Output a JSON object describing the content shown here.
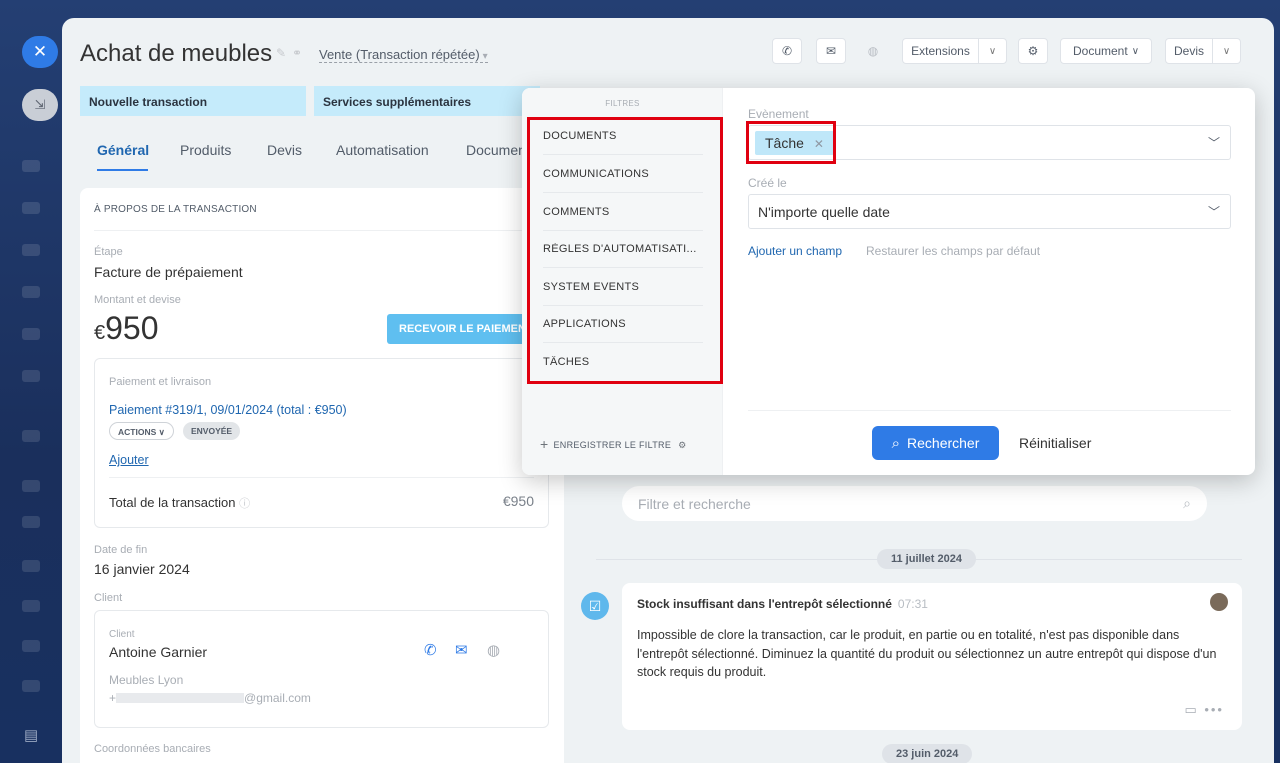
{
  "window": {
    "title": "Achat de meubles",
    "subtitle": "Vente (Transaction répétée)"
  },
  "toolbar": {
    "extensions_label": "Extensions",
    "document_label": "Document",
    "devis_label": "Devis"
  },
  "stages": [
    "Nouvelle transaction",
    "Services supplémentaires"
  ],
  "tabs": [
    "Général",
    "Produits",
    "Devis",
    "Automatisation",
    "Documents"
  ],
  "deal": {
    "section_title": "À PROPOS DE LA TRANSACTION",
    "stage_label": "Étape",
    "stage_value": "Facture de prépaiement",
    "amount_label": "Montant et devise",
    "currency": "€",
    "amount": "950",
    "pay_button": "RECEVOIR LE PAIEMENT",
    "payment_section_label": "Paiement et livraison",
    "payment_link": "Paiement #319/1, 09/01/2024 (total : €950)",
    "actions_pill": "ACTIONS",
    "sent_pill": "ENVOYÉE",
    "add_link": "Ajouter",
    "total_label": "Total de la transaction",
    "total_value": "€950",
    "end_date_label": "Date de fin",
    "end_date_value": "16 janvier 2024",
    "client_section_label": "Client",
    "client_label": "Client",
    "client_name": "Antoine Garnier",
    "company": "Meubles Lyon",
    "phone_prefix": "+",
    "email_suffix": "@gmail.com",
    "bank_label": "Coordonnées bancaires"
  },
  "timeline": {
    "search_placeholder": "Filtre et recherche",
    "date1": "11 juillet 2024",
    "date2": "23 juin 2024",
    "event_title": "Stock insuffisant dans l'entrepôt sélectionné",
    "event_time": "07:31",
    "event_text": "Impossible de clore la transaction, car le produit, en partie ou en totalité, n'est pas disponible dans l'entrepôt sélectionné. Diminuez la quantité du produit ou sélectionnez un autre entrepôt qui dispose d'un stock requis du produit."
  },
  "filter_popup": {
    "filters_title": "FILTRES",
    "items": [
      "DOCUMENTS",
      "COMMUNICATIONS",
      "COMMENTS",
      "RÈGLES D'AUTOMATISATI...",
      "SYSTEM EVENTS",
      "APPLICATIONS",
      "TÂCHES"
    ],
    "save_filter": "ENREGISTRER LE FILTRE",
    "event_label": "Evènement",
    "event_tag": "Tâche",
    "created_label": "Créé le",
    "created_value": "N'importe quelle date",
    "add_field": "Ajouter un champ",
    "restore_fields": "Restaurer les champs par défaut",
    "search_button": "Rechercher",
    "reset_button": "Réinitialiser"
  },
  "colors": {
    "accent": "#2f7be6",
    "highlight": "#e00010",
    "stage": "#c5ebfb"
  }
}
